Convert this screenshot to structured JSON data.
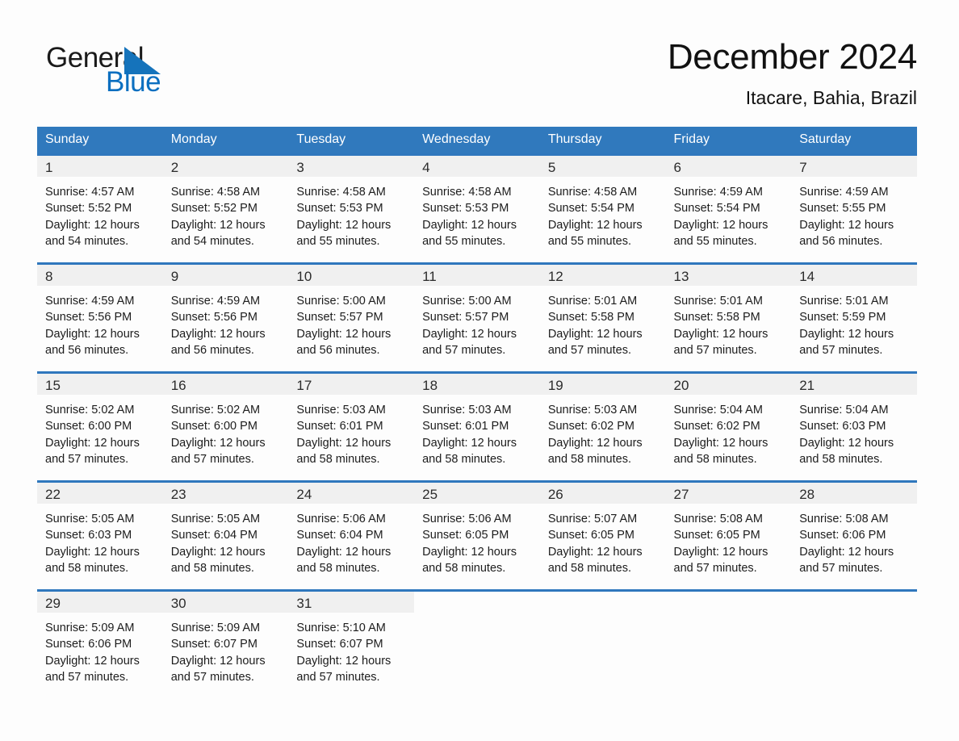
{
  "brand": {
    "name_part1": "General",
    "name_part2": "Blue",
    "accent_color": "#1573bb",
    "blue_text_color": "#0b6fc0"
  },
  "header": {
    "title": "December 2024",
    "subtitle": "Itacare, Bahia, Brazil"
  },
  "theme": {
    "header_row_bg": "#3079bd",
    "row_divider": "#2f77bd",
    "daynum_band_bg": "#f0f0f0",
    "page_bg": "#fdfdfd"
  },
  "weekday_headers": [
    "Sunday",
    "Monday",
    "Tuesday",
    "Wednesday",
    "Thursday",
    "Friday",
    "Saturday"
  ],
  "weeks": [
    [
      {
        "day": "1",
        "sunrise": "Sunrise: 4:57 AM",
        "sunset": "Sunset: 5:52 PM",
        "daylight": "Daylight: 12 hours and 54 minutes."
      },
      {
        "day": "2",
        "sunrise": "Sunrise: 4:58 AM",
        "sunset": "Sunset: 5:52 PM",
        "daylight": "Daylight: 12 hours and 54 minutes."
      },
      {
        "day": "3",
        "sunrise": "Sunrise: 4:58 AM",
        "sunset": "Sunset: 5:53 PM",
        "daylight": "Daylight: 12 hours and 55 minutes."
      },
      {
        "day": "4",
        "sunrise": "Sunrise: 4:58 AM",
        "sunset": "Sunset: 5:53 PM",
        "daylight": "Daylight: 12 hours and 55 minutes."
      },
      {
        "day": "5",
        "sunrise": "Sunrise: 4:58 AM",
        "sunset": "Sunset: 5:54 PM",
        "daylight": "Daylight: 12 hours and 55 minutes."
      },
      {
        "day": "6",
        "sunrise": "Sunrise: 4:59 AM",
        "sunset": "Sunset: 5:54 PM",
        "daylight": "Daylight: 12 hours and 55 minutes."
      },
      {
        "day": "7",
        "sunrise": "Sunrise: 4:59 AM",
        "sunset": "Sunset: 5:55 PM",
        "daylight": "Daylight: 12 hours and 56 minutes."
      }
    ],
    [
      {
        "day": "8",
        "sunrise": "Sunrise: 4:59 AM",
        "sunset": "Sunset: 5:56 PM",
        "daylight": "Daylight: 12 hours and 56 minutes."
      },
      {
        "day": "9",
        "sunrise": "Sunrise: 4:59 AM",
        "sunset": "Sunset: 5:56 PM",
        "daylight": "Daylight: 12 hours and 56 minutes."
      },
      {
        "day": "10",
        "sunrise": "Sunrise: 5:00 AM",
        "sunset": "Sunset: 5:57 PM",
        "daylight": "Daylight: 12 hours and 56 minutes."
      },
      {
        "day": "11",
        "sunrise": "Sunrise: 5:00 AM",
        "sunset": "Sunset: 5:57 PM",
        "daylight": "Daylight: 12 hours and 57 minutes."
      },
      {
        "day": "12",
        "sunrise": "Sunrise: 5:01 AM",
        "sunset": "Sunset: 5:58 PM",
        "daylight": "Daylight: 12 hours and 57 minutes."
      },
      {
        "day": "13",
        "sunrise": "Sunrise: 5:01 AM",
        "sunset": "Sunset: 5:58 PM",
        "daylight": "Daylight: 12 hours and 57 minutes."
      },
      {
        "day": "14",
        "sunrise": "Sunrise: 5:01 AM",
        "sunset": "Sunset: 5:59 PM",
        "daylight": "Daylight: 12 hours and 57 minutes."
      }
    ],
    [
      {
        "day": "15",
        "sunrise": "Sunrise: 5:02 AM",
        "sunset": "Sunset: 6:00 PM",
        "daylight": "Daylight: 12 hours and 57 minutes."
      },
      {
        "day": "16",
        "sunrise": "Sunrise: 5:02 AM",
        "sunset": "Sunset: 6:00 PM",
        "daylight": "Daylight: 12 hours and 57 minutes."
      },
      {
        "day": "17",
        "sunrise": "Sunrise: 5:03 AM",
        "sunset": "Sunset: 6:01 PM",
        "daylight": "Daylight: 12 hours and 58 minutes."
      },
      {
        "day": "18",
        "sunrise": "Sunrise: 5:03 AM",
        "sunset": "Sunset: 6:01 PM",
        "daylight": "Daylight: 12 hours and 58 minutes."
      },
      {
        "day": "19",
        "sunrise": "Sunrise: 5:03 AM",
        "sunset": "Sunset: 6:02 PM",
        "daylight": "Daylight: 12 hours and 58 minutes."
      },
      {
        "day": "20",
        "sunrise": "Sunrise: 5:04 AM",
        "sunset": "Sunset: 6:02 PM",
        "daylight": "Daylight: 12 hours and 58 minutes."
      },
      {
        "day": "21",
        "sunrise": "Sunrise: 5:04 AM",
        "sunset": "Sunset: 6:03 PM",
        "daylight": "Daylight: 12 hours and 58 minutes."
      }
    ],
    [
      {
        "day": "22",
        "sunrise": "Sunrise: 5:05 AM",
        "sunset": "Sunset: 6:03 PM",
        "daylight": "Daylight: 12 hours and 58 minutes."
      },
      {
        "day": "23",
        "sunrise": "Sunrise: 5:05 AM",
        "sunset": "Sunset: 6:04 PM",
        "daylight": "Daylight: 12 hours and 58 minutes."
      },
      {
        "day": "24",
        "sunrise": "Sunrise: 5:06 AM",
        "sunset": "Sunset: 6:04 PM",
        "daylight": "Daylight: 12 hours and 58 minutes."
      },
      {
        "day": "25",
        "sunrise": "Sunrise: 5:06 AM",
        "sunset": "Sunset: 6:05 PM",
        "daylight": "Daylight: 12 hours and 58 minutes."
      },
      {
        "day": "26",
        "sunrise": "Sunrise: 5:07 AM",
        "sunset": "Sunset: 6:05 PM",
        "daylight": "Daylight: 12 hours and 58 minutes."
      },
      {
        "day": "27",
        "sunrise": "Sunrise: 5:08 AM",
        "sunset": "Sunset: 6:05 PM",
        "daylight": "Daylight: 12 hours and 57 minutes."
      },
      {
        "day": "28",
        "sunrise": "Sunrise: 5:08 AM",
        "sunset": "Sunset: 6:06 PM",
        "daylight": "Daylight: 12 hours and 57 minutes."
      }
    ],
    [
      {
        "day": "29",
        "sunrise": "Sunrise: 5:09 AM",
        "sunset": "Sunset: 6:06 PM",
        "daylight": "Daylight: 12 hours and 57 minutes."
      },
      {
        "day": "30",
        "sunrise": "Sunrise: 5:09 AM",
        "sunset": "Sunset: 6:07 PM",
        "daylight": "Daylight: 12 hours and 57 minutes."
      },
      {
        "day": "31",
        "sunrise": "Sunrise: 5:10 AM",
        "sunset": "Sunset: 6:07 PM",
        "daylight": "Daylight: 12 hours and 57 minutes."
      },
      {
        "day": "",
        "sunrise": "",
        "sunset": "",
        "daylight": ""
      },
      {
        "day": "",
        "sunrise": "",
        "sunset": "",
        "daylight": ""
      },
      {
        "day": "",
        "sunrise": "",
        "sunset": "",
        "daylight": ""
      },
      {
        "day": "",
        "sunrise": "",
        "sunset": "",
        "daylight": ""
      }
    ]
  ]
}
